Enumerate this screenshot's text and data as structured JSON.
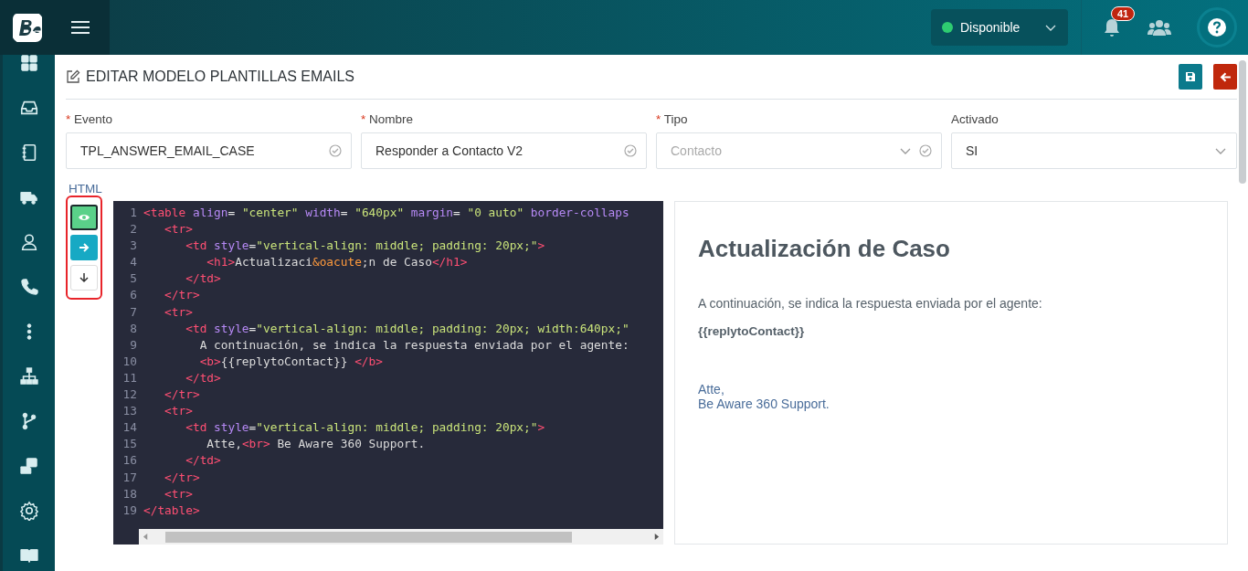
{
  "header": {
    "status": {
      "label": "Disponible",
      "color": "#2ecc71"
    },
    "notifications": {
      "count": "41"
    }
  },
  "page": {
    "title": "EDITAR MODELO PLANTILLAS EMAILS",
    "fields": [
      {
        "label": "Evento",
        "required_mark": "*",
        "kind": "text",
        "value": "TPL_ANSWER_EMAIL_CASE",
        "disabled": false
      },
      {
        "label": "Nombre",
        "required_mark": "*",
        "kind": "text",
        "value": "Responder a Contacto V2",
        "disabled": false
      },
      {
        "label": "Tipo",
        "required_mark": "*",
        "kind": "select-validated",
        "value": "Contacto",
        "disabled": true
      },
      {
        "label": "Activado",
        "kind": "select",
        "value": "SI",
        "disabled": false
      }
    ]
  },
  "editor": {
    "label": "HTML",
    "tools": [
      {
        "kind": "preview",
        "selected": true
      },
      {
        "kind": "move-right",
        "selected": false
      },
      {
        "kind": "move-down",
        "selected": false
      }
    ],
    "lines": [
      {
        "number": "1",
        "tokens": [
          {
            "kind": "tag",
            "text": "<table"
          },
          {
            "kind": "attr",
            "text": " align"
          },
          {
            "kind": "punct",
            "text": "= "
          },
          {
            "kind": "str",
            "text": "\"center\""
          },
          {
            "kind": "attr",
            "text": " width"
          },
          {
            "kind": "punct",
            "text": "= "
          },
          {
            "kind": "str",
            "text": "\"640px\""
          },
          {
            "kind": "attr",
            "text": " margin"
          },
          {
            "kind": "punct",
            "text": "= "
          },
          {
            "kind": "str",
            "text": "\"0 auto\""
          },
          {
            "kind": "attr",
            "text": " border-collaps"
          }
        ]
      },
      {
        "number": "2",
        "tokens": [
          {
            "kind": "tag",
            "text": "   <tr>"
          }
        ]
      },
      {
        "number": "3",
        "tokens": [
          {
            "kind": "tag",
            "text": "      <td"
          },
          {
            "kind": "attr",
            "text": " style"
          },
          {
            "kind": "punct",
            "text": "="
          },
          {
            "kind": "str",
            "text": "\"vertical-align: middle; padding: 20px;\""
          },
          {
            "kind": "tag",
            "text": ">"
          }
        ]
      },
      {
        "number": "4",
        "tokens": [
          {
            "kind": "tag",
            "text": "         <h1>"
          },
          {
            "kind": "text",
            "text": "Actualizaci"
          },
          {
            "kind": "entity",
            "text": "&oacute"
          },
          {
            "kind": "text",
            "text": ";n de Caso"
          },
          {
            "kind": "tag",
            "text": "</h1>"
          }
        ]
      },
      {
        "number": "5",
        "tokens": [
          {
            "kind": "tag",
            "text": "      </td>"
          }
        ]
      },
      {
        "number": "6",
        "tokens": [
          {
            "kind": "tag",
            "text": "   </tr>"
          }
        ]
      },
      {
        "number": "7",
        "tokens": [
          {
            "kind": "tag",
            "text": "   <tr>"
          }
        ]
      },
      {
        "number": "8",
        "tokens": [
          {
            "kind": "tag",
            "text": "      <td"
          },
          {
            "kind": "attr",
            "text": " style"
          },
          {
            "kind": "punct",
            "text": "="
          },
          {
            "kind": "str",
            "text": "\"vertical-align: middle; padding: 20px; width:640px;\""
          }
        ]
      },
      {
        "number": "9",
        "tokens": [
          {
            "kind": "text",
            "text": "        A continuación, se indica la respuesta enviada por el agente:"
          }
        ]
      },
      {
        "number": "10",
        "tokens": [
          {
            "kind": "tag",
            "text": "        <b>"
          },
          {
            "kind": "text",
            "text": "{{replytoContact}} "
          },
          {
            "kind": "tag",
            "text": "</b>"
          }
        ]
      },
      {
        "number": "11",
        "tokens": [
          {
            "kind": "tag",
            "text": "      </td>"
          }
        ]
      },
      {
        "number": "12",
        "tokens": [
          {
            "kind": "tag",
            "text": "   </tr>"
          }
        ]
      },
      {
        "number": "13",
        "tokens": [
          {
            "kind": "tag",
            "text": "   <tr>"
          }
        ]
      },
      {
        "number": "14",
        "tokens": [
          {
            "kind": "tag",
            "text": "      <td"
          },
          {
            "kind": "attr",
            "text": " style"
          },
          {
            "kind": "punct",
            "text": "="
          },
          {
            "kind": "str",
            "text": "\"vertical-align: middle; padding: 20px;\""
          },
          {
            "kind": "tag",
            "text": ">"
          }
        ]
      },
      {
        "number": "15",
        "tokens": [
          {
            "kind": "text",
            "text": "         Atte,"
          },
          {
            "kind": "tag",
            "text": "<br>"
          },
          {
            "kind": "text",
            "text": " Be Aware 360 Support."
          }
        ]
      },
      {
        "number": "16",
        "tokens": [
          {
            "kind": "tag",
            "text": "      </td>"
          }
        ]
      },
      {
        "number": "17",
        "tokens": [
          {
            "kind": "tag",
            "text": "   </tr>"
          }
        ]
      },
      {
        "number": "18",
        "tokens": [
          {
            "kind": "tag",
            "text": "   <tr>"
          }
        ]
      },
      {
        "number": "19",
        "tokens": [
          {
            "kind": "tag",
            "text": "</table>"
          }
        ]
      }
    ]
  },
  "preview": {
    "heading": "Actualización de Caso",
    "intro": "A continuación, se indica la respuesta enviada por el agente:",
    "variable": "{{replytoContact}}",
    "closing": [
      "Atte,",
      "Be Aware 360 Support."
    ]
  }
}
